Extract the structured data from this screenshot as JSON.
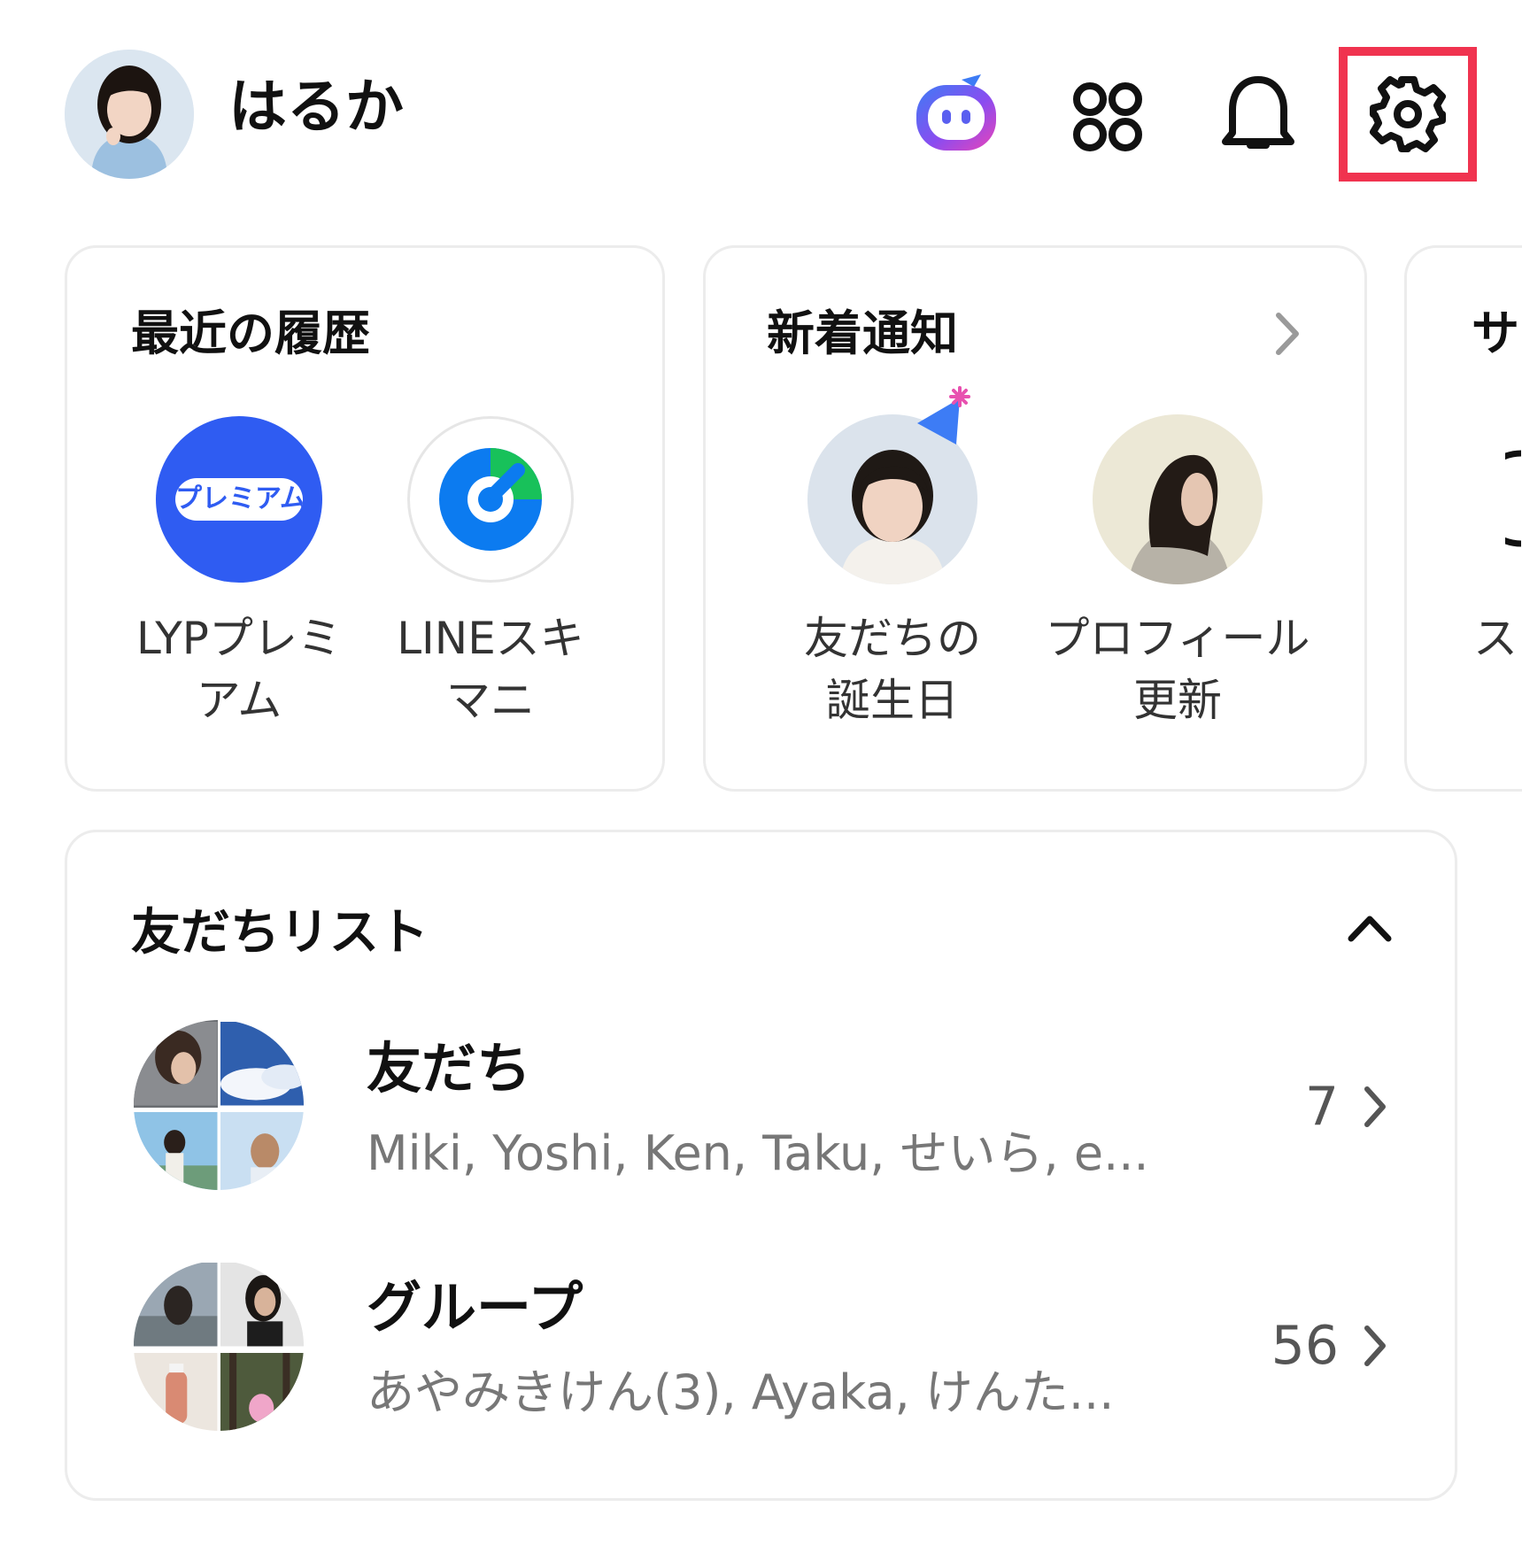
{
  "header": {
    "username": "はるか",
    "icons": [
      "ai-assistant-icon",
      "apps-grid-icon",
      "bell-icon",
      "gear-icon"
    ],
    "highlight_color": "#f0334f"
  },
  "recent_history": {
    "title": "最近の履歴",
    "items": [
      {
        "label_line1": "LYPプレミ",
        "label_line2": "アム",
        "badge_text": "プレミアム",
        "color": "#2f5cf2"
      },
      {
        "label_line1": "LINEスキ",
        "label_line2": "マニ",
        "color": "#0c7bf0"
      }
    ]
  },
  "new_notifications": {
    "title": "新着通知",
    "items": [
      {
        "label_line1": "友だちの",
        "label_line2": "誕生日"
      },
      {
        "label_line1": "プロフィール",
        "label_line2": "更新"
      }
    ]
  },
  "third_card": {
    "title_partial": "サ",
    "item_partial": "ス"
  },
  "friend_list": {
    "title": "友だちリスト",
    "rows": [
      {
        "title": "友だち",
        "subtitle": "Miki, Yoshi, Ken, Taku, せいら, e...",
        "count": "7"
      },
      {
        "title": "グループ",
        "subtitle": "あやみきけん(3), Ayaka, けんた...",
        "count": "56"
      }
    ]
  }
}
